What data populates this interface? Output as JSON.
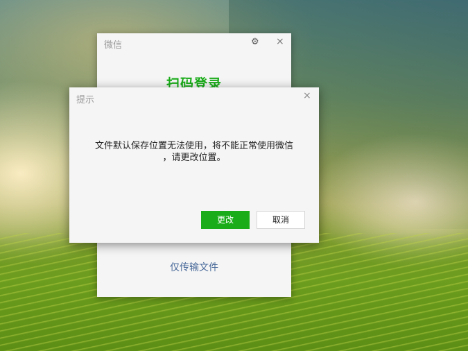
{
  "login_window": {
    "title": "微信",
    "gear_icon": "⚙",
    "close_icon": "×",
    "heading": "扫码登录",
    "transfer_link": "仅传输文件"
  },
  "dialog": {
    "title": "提示",
    "close_icon": "×",
    "message_line1": "文件默认保存位置无法使用，将不能正常使用微信",
    "message_line2": "，请更改位置。",
    "primary_button": "更改",
    "secondary_button": "取消"
  },
  "colors": {
    "accent": "#1aad19",
    "link": "#4a6b9a"
  }
}
